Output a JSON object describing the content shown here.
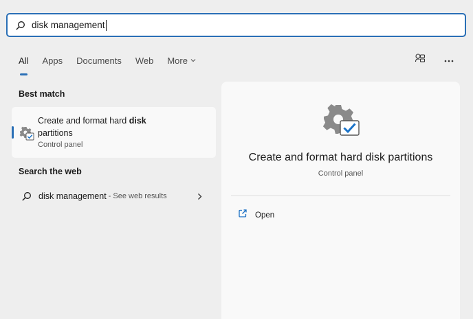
{
  "search": {
    "query": "disk management",
    "icon": "search-icon"
  },
  "tabs": [
    {
      "label": "All",
      "active": true
    },
    {
      "label": "Apps",
      "active": false
    },
    {
      "label": "Documents",
      "active": false
    },
    {
      "label": "Web",
      "active": false
    },
    {
      "label": "More",
      "active": false
    }
  ],
  "toolbar": {
    "share_icon": "account-switch-icon",
    "more_icon": "ellipsis-icon"
  },
  "best_match": {
    "section_title": "Best match",
    "title_prefix": "Create and format hard ",
    "title_bold": "disk",
    "title_suffix": "partitions",
    "subtitle": "Control panel"
  },
  "web": {
    "section_title": "Search the web",
    "query": "disk management",
    "hint": "- See web results"
  },
  "detail": {
    "title": "Create and format hard disk partitions",
    "subtitle": "Control panel",
    "actions": [
      {
        "label": "Open",
        "icon": "open-external-icon"
      }
    ]
  },
  "colors": {
    "accent": "#2a6fb6",
    "background": "#eeeeee",
    "card": "#f9f9f9"
  }
}
